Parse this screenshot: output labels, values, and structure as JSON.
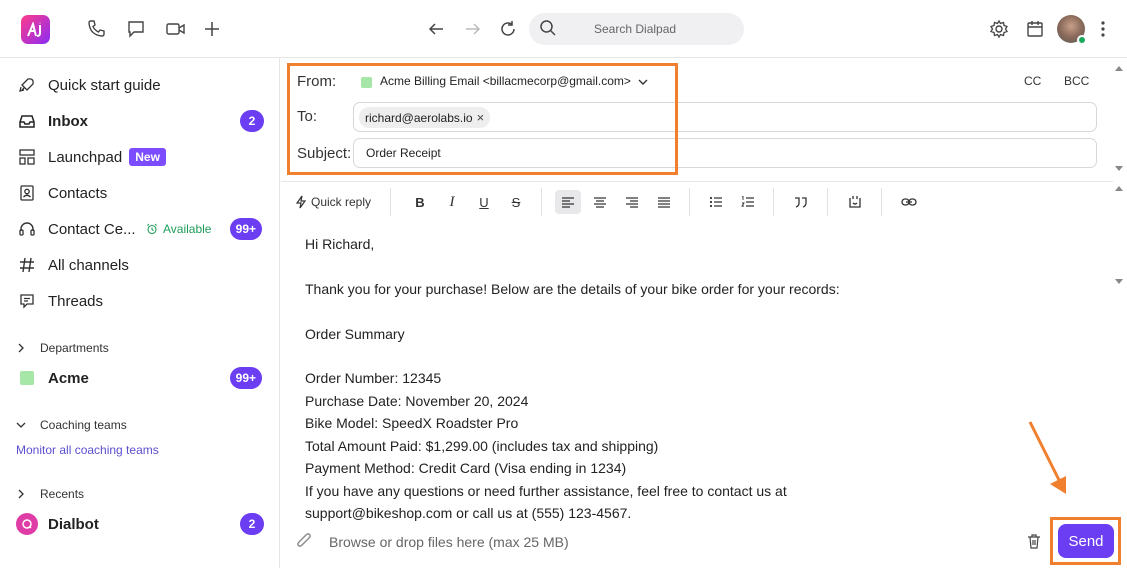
{
  "topbar": {
    "search_placeholder": "Search Dialpad",
    "icons": [
      "phone-icon",
      "chat-icon",
      "video-icon",
      "plus-icon",
      "back-arrow-icon",
      "forward-arrow-icon",
      "refresh-icon",
      "search-icon",
      "gear-icon",
      "calendar-icon",
      "more-icon"
    ]
  },
  "sidebar": {
    "items": [
      {
        "label": "Quick start guide"
      },
      {
        "label": "Inbox",
        "badge": "2"
      },
      {
        "label": "Launchpad",
        "pill": "New"
      },
      {
        "label": "Contacts"
      },
      {
        "label": "Contact Ce...",
        "status": "Available",
        "badge": "99+"
      },
      {
        "label": "All channels"
      },
      {
        "label": "Threads"
      }
    ],
    "departments": {
      "header": "Departments",
      "items": [
        {
          "label": "Acme",
          "badge": "99+"
        }
      ]
    },
    "coaching": {
      "header": "Coaching teams",
      "link": "Monitor all coaching teams"
    },
    "recents": {
      "header": "Recents",
      "items": [
        {
          "label": "Dialbot",
          "badge": "2"
        }
      ]
    }
  },
  "compose": {
    "from_label": "From:",
    "from_value": "Acme Billing Email <billacmecorp@gmail.com>",
    "cc_label": "CC",
    "bcc_label": "BCC",
    "to_label": "To:",
    "to_chip": "richard@aerolabs.io",
    "subject_label": "Subject:",
    "subject_value": "Order Receipt"
  },
  "toolbar": {
    "quick_reply": "Quick reply",
    "bold": "B",
    "italic": "I",
    "underline": "U",
    "strike": "S"
  },
  "body": {
    "lines": [
      "Hi Richard,",
      "Thank you for your purchase! Below are the details of your bike order for your records:",
      "Order Summary",
      "Order Number: 12345",
      "Purchase Date: November 20, 2024",
      "Bike Model: SpeedX Roadster Pro",
      "Total Amount Paid: $1,299.00 (includes tax and shipping)",
      "Payment Method: Credit Card (Visa ending in 1234)",
      "If you have any questions or need further assistance, feel free to contact us at",
      "support@bikeshop.com or call us at (555) 123-4567."
    ]
  },
  "footer": {
    "attach_text": "Browse or drop files here (max 25 MB)",
    "send_label": "Send"
  },
  "colors": {
    "accent": "#6b3df3",
    "highlight": "#f07f2e",
    "available": "#1f9e5b"
  }
}
